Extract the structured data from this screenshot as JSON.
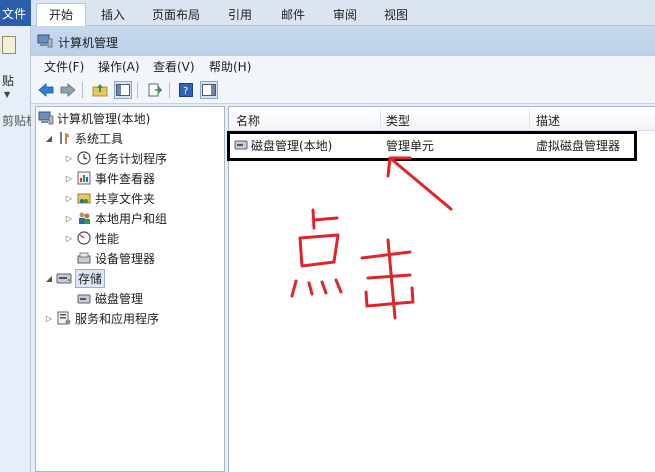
{
  "ribbon": {
    "file_tab": "文件",
    "tabs": [
      "开始",
      "插入",
      "页面布局",
      "引用",
      "邮件",
      "审阅",
      "视图"
    ],
    "paste_label": "贴",
    "clipboard_label": "剪贴板"
  },
  "window": {
    "title": "计算机管理",
    "menu": [
      "文件(F)",
      "操作(A)",
      "查看(V)",
      "帮助(H)"
    ]
  },
  "tree": {
    "items": [
      {
        "label": "计算机管理(本地)",
        "level": 0
      },
      {
        "label": "系统工具",
        "level": 1
      },
      {
        "label": "任务计划程序",
        "level": 2
      },
      {
        "label": "事件查看器",
        "level": 2
      },
      {
        "label": "共享文件夹",
        "level": 2
      },
      {
        "label": "本地用户和组",
        "level": 2
      },
      {
        "label": "性能",
        "level": 2
      },
      {
        "label": "设备管理器",
        "level": 2
      },
      {
        "label": "存储",
        "level": 1
      },
      {
        "label": "磁盘管理",
        "level": 2
      },
      {
        "label": "服务和应用程序",
        "level": 1
      }
    ]
  },
  "list": {
    "columns": [
      "名称",
      "类型",
      "描述"
    ],
    "rows": [
      {
        "name": "磁盘管理(本地)",
        "type": "管理单元",
        "description": "虚拟磁盘管理器"
      }
    ]
  },
  "colors": {
    "annotation": "#e0252a",
    "file_tab": "#2a5ea8"
  }
}
